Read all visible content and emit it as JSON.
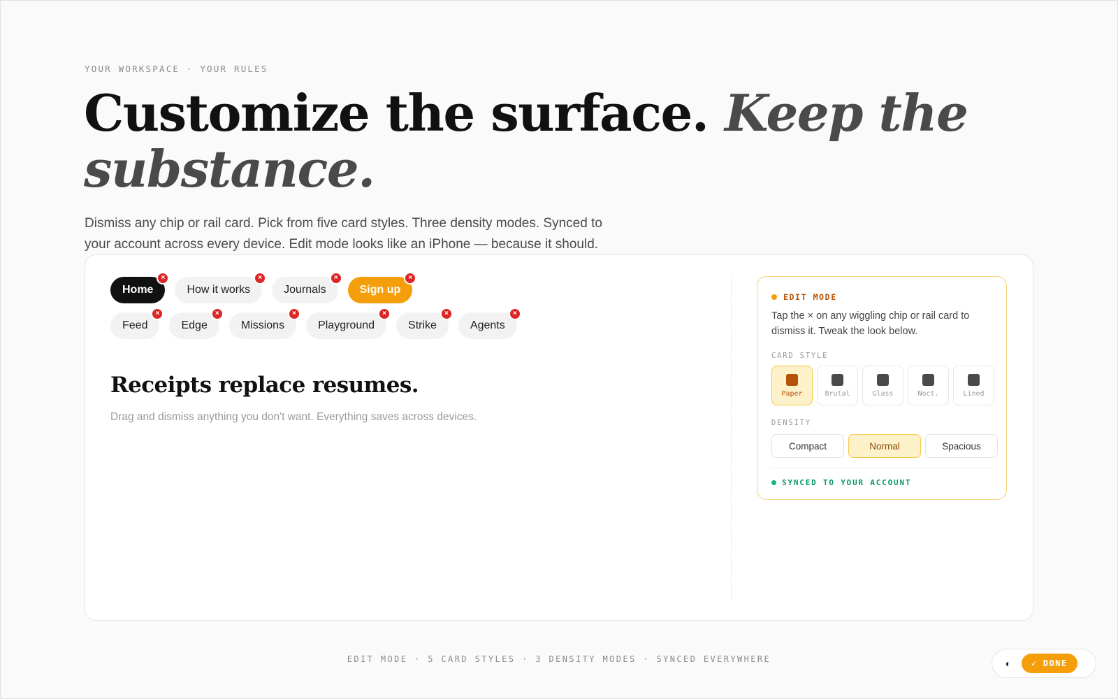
{
  "hero": {
    "eyebrow": "YOUR WORKSPACE · YOUR RULES",
    "headline_plain": "Customize the surface. ",
    "headline_accent": "Keep the substance.",
    "lede": "Dismiss any chip or rail card. Pick from five card styles. Three density modes. Synced to your account across every device. Edit mode looks like an iPhone — because it should."
  },
  "chips": {
    "dismiss_glyph": "×",
    "row1": [
      {
        "label": "Home",
        "state": "active"
      },
      {
        "label": "How it works",
        "state": "default"
      },
      {
        "label": "Journals",
        "state": "default"
      },
      {
        "label": "Sign up",
        "state": "cta"
      }
    ],
    "row2": [
      {
        "label": "Feed"
      },
      {
        "label": "Edge"
      },
      {
        "label": "Missions"
      },
      {
        "label": "Playground"
      },
      {
        "label": "Strike"
      },
      {
        "label": "Agents"
      }
    ]
  },
  "content": {
    "title": "Receipts replace resumes.",
    "subtitle": "Drag and dismiss anything you don't want. Everything saves across devices."
  },
  "edit_panel": {
    "title": "EDIT MODE",
    "description": "Tap the × on any wiggling chip or rail card to dismiss it. Tweak the look below.",
    "card_style_label": "CARD STYLE",
    "card_styles": [
      "Paper",
      "Brutal",
      "Glass",
      "Noct.",
      "Lined"
    ],
    "selected_style": "Paper",
    "density_label": "DENSITY",
    "densities": [
      "Compact",
      "Normal",
      "Spacious"
    ],
    "selected_density": "Normal",
    "synced_text": "SYNCED TO YOUR ACCOUNT"
  },
  "footer": {
    "text": "EDIT MODE · 5 CARD STYLES · 3 DENSITY MODES · SYNCED EVERYWHERE"
  },
  "toolbar": {
    "theme_icon": "◐",
    "done_label": "DONE",
    "done_icon": "✓"
  },
  "colors": {
    "accent": "#f59e0b",
    "dismiss": "#dc2626",
    "synced": "#059669"
  }
}
